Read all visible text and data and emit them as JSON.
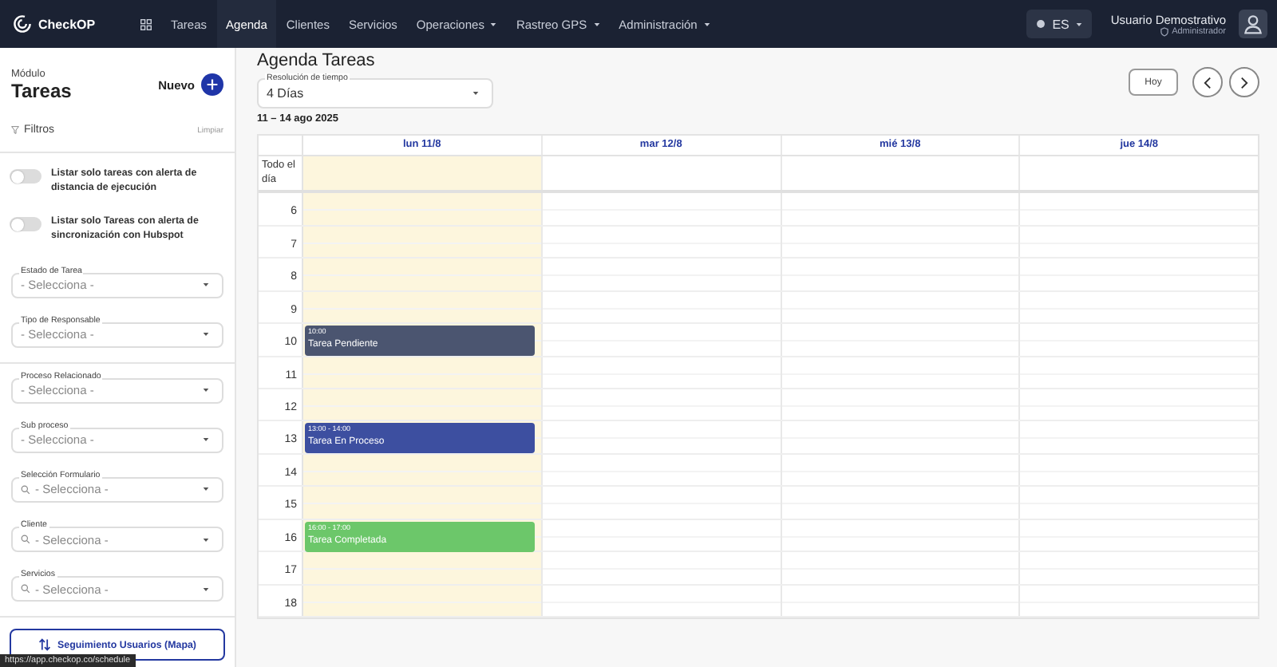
{
  "nav": {
    "brand": "CheckOP",
    "items": [
      {
        "label": "Tareas",
        "selected": false,
        "dropdown": false
      },
      {
        "label": "Agenda",
        "selected": true,
        "dropdown": false
      },
      {
        "label": "Clientes",
        "selected": false,
        "dropdown": false
      },
      {
        "label": "Servicios",
        "selected": false,
        "dropdown": false
      },
      {
        "label": "Operaciones",
        "selected": false,
        "dropdown": true
      },
      {
        "label": "Rastreo GPS",
        "selected": false,
        "dropdown": true
      },
      {
        "label": "Administración",
        "selected": false,
        "dropdown": true
      }
    ],
    "language": "ES",
    "user": {
      "name": "Usuario Demostrativo",
      "role": "Administrador"
    }
  },
  "sidebar": {
    "module_label": "Módulo",
    "module_title": "Tareas",
    "new_button": "Nuevo",
    "filters_label": "Filtros",
    "clear_link": "Limpiar",
    "toggles": [
      {
        "label": "Listar solo tareas con alerta de distancia de ejecución",
        "on": false
      },
      {
        "label": "Listar solo Tareas con alerta de sincronización con Hubspot",
        "on": false
      }
    ],
    "filters": [
      {
        "label": "Estado de Tarea",
        "placeholder": "- Selecciona -",
        "searchable": false,
        "divider_after": false
      },
      {
        "label": "Tipo de Responsable",
        "placeholder": "- Selecciona -",
        "searchable": false,
        "divider_after": true
      },
      {
        "label": "Proceso Relacionado",
        "placeholder": "- Selecciona -",
        "searchable": false,
        "divider_after": false
      },
      {
        "label": "Sub proceso",
        "placeholder": "- Selecciona -",
        "searchable": false,
        "divider_after": false
      },
      {
        "label": "Selección Formulario",
        "placeholder": "- Selecciona -",
        "searchable": true,
        "divider_after": false
      },
      {
        "label": "Cliente",
        "placeholder": "- Selecciona -",
        "searchable": true,
        "divider_after": false
      },
      {
        "label": "Servicios",
        "placeholder": "- Selecciona -",
        "searchable": true,
        "divider_after": false
      }
    ],
    "map_button": "Seguimiento Usuarios (Mapa)"
  },
  "agenda": {
    "title": "Agenda Tareas",
    "resolution": {
      "label": "Resolución de tiempo",
      "value": "4 Días"
    },
    "range": "11 – 14 ago 2025",
    "today_button": "Hoy",
    "days": [
      {
        "label": "lun 11/8",
        "today": true
      },
      {
        "label": "mar 12/8",
        "today": false
      },
      {
        "label": "mié 13/8",
        "today": false
      },
      {
        "label": "jue 14/8",
        "today": false
      }
    ],
    "all_day_label": "Todo el día",
    "hours": [
      {
        "label": "6"
      },
      {
        "label": "7"
      },
      {
        "label": "8"
      },
      {
        "label": "9"
      },
      {
        "label": "10",
        "events": [
          {
            "time": "10:00",
            "title": "Tarea Pendiente",
            "color": "#4b5570"
          }
        ]
      },
      {
        "label": "11"
      },
      {
        "label": "12"
      },
      {
        "label": "13",
        "events": [
          {
            "time": "13:00 - 14:00",
            "title": "Tarea En Proceso",
            "color": "#3d4fa0"
          }
        ]
      },
      {
        "label": "14"
      },
      {
        "label": "15"
      },
      {
        "label": "16",
        "events": [
          {
            "time": "16:00 - 17:00",
            "title": "Tarea Completada",
            "color": "#6cc76a"
          }
        ]
      },
      {
        "label": "17"
      },
      {
        "label": "18"
      }
    ]
  },
  "status_url": "https://app.checkop.co/schedule"
}
